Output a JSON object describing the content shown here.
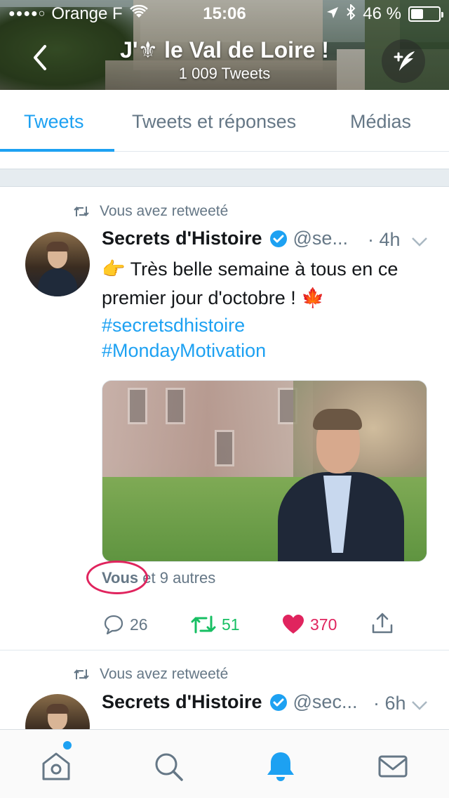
{
  "status_bar": {
    "signal": "●●●●○",
    "carrier": "Orange F",
    "time": "15:06",
    "battery": "46 %",
    "battery_level": 0.46
  },
  "header": {
    "title": "J'⚜ le Val de Loire !",
    "tweet_count": "1 009 Tweets"
  },
  "tabs": [
    {
      "label": "Tweets",
      "active": true
    },
    {
      "label": "Tweets et réponses",
      "active": false
    },
    {
      "label": "Médias",
      "active": false
    }
  ],
  "tweets": [
    {
      "retweet_label": "Vous avez retweeté",
      "author_name": "Secrets d'Histoire",
      "handle": "@se...",
      "time": "· 4h",
      "text_line1": "👉 Très belle semaine à tous en ce",
      "text_line2": "premier jour d'octobre ! 🍁",
      "hashtag1": "#secretsdhistoire",
      "hashtag2": "#MondayMotivation",
      "liked_by_you": "Vous",
      "liked_by_others": "et 9 autres",
      "replies": "26",
      "retweets": "51",
      "likes": "370"
    },
    {
      "retweet_label": "Vous avez retweeté",
      "author_name": "Secrets d'Histoire",
      "handle": "@sec...",
      "time": "· 6h"
    }
  ],
  "colors": {
    "accent": "#1da1f2",
    "retweet": "#17bf63",
    "like": "#e0245e",
    "secondary_text": "#657786"
  },
  "bottom_nav": [
    "home-icon",
    "search-icon",
    "notifications-icon",
    "messages-icon"
  ]
}
